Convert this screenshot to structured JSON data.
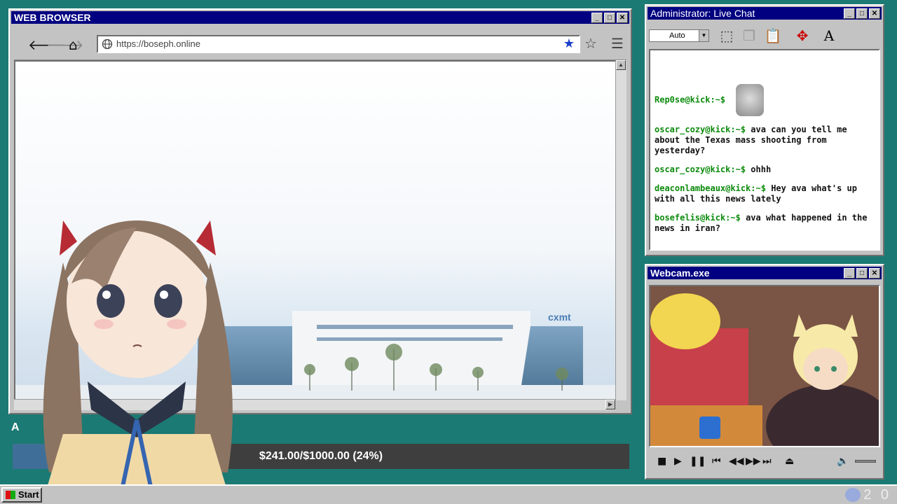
{
  "browser": {
    "title": "WEB BROWSER",
    "url": "https://boseph.online",
    "site_logo": "cxmt",
    "icons": {
      "back": "back-arrow-icon",
      "forward": "forward-arrow-icon",
      "home": "home-icon",
      "globe": "globe-icon",
      "bookmarked": "star-filled-icon",
      "favorites": "star-outline-icon",
      "menu": "hamburger-menu-icon"
    }
  },
  "chat": {
    "title": "Administrator: Live Chat",
    "font_size": "Auto",
    "messages": [
      {
        "user": "Rep0se@kick:~$",
        "text": ""
      },
      {
        "user": "oscar_cozy@kick:~$",
        "text": "ava can you tell me about the Texas mass shooting from yesterday?"
      },
      {
        "user": "oscar_cozy@kick:~$",
        "text": "ohhh"
      },
      {
        "user": "deaconlambeaux@kick:~$",
        "text": "Hey ava what's up with all this news lately"
      },
      {
        "user": "bosefelis@kick:~$",
        "text": "ava what happened in the news in iran?"
      }
    ],
    "toolbar_icons": [
      "select-icon",
      "copy-icon",
      "paste-icon",
      "move-icon",
      "font-icon"
    ]
  },
  "webcam": {
    "title": "Webcam.exe",
    "controls": [
      "stop-icon",
      "play-icon",
      "pause-icon",
      "skip-back-icon",
      "rewind-icon",
      "fast-forward-icon",
      "skip-forward-icon",
      "eject-icon",
      "volume-icon"
    ]
  },
  "donation": {
    "label": "A",
    "text": "$241.00/$1000.00 (24%)",
    "progress": 0.24
  },
  "taskbar": {
    "start": "Start",
    "clock": "2 0"
  },
  "colors": {
    "desktop": "#1b7a73",
    "titlebar": "#000080",
    "chat_username": "#0b8a0b",
    "donation_fill": "#3f6f98"
  }
}
